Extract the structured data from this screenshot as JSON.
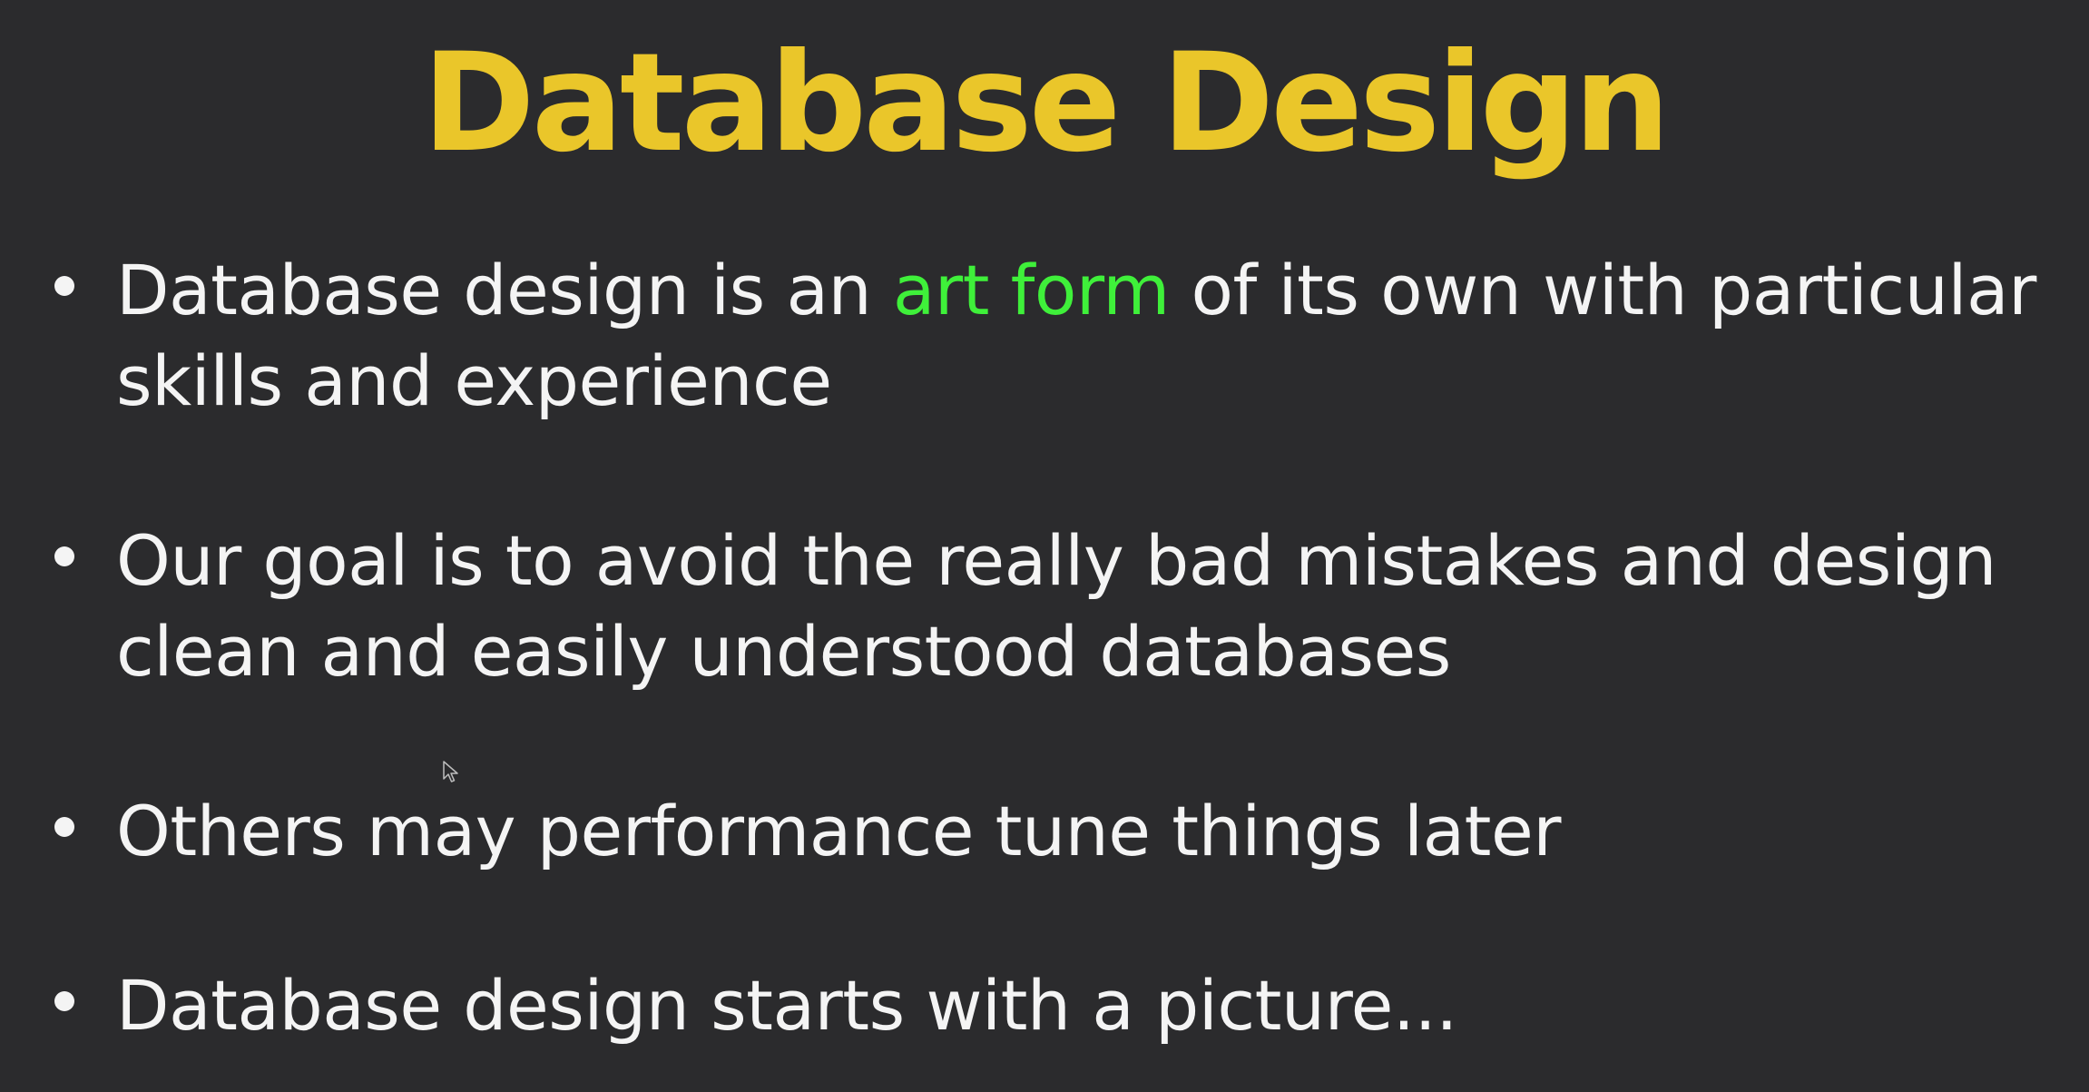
{
  "slide": {
    "title": "Database Design",
    "colors": {
      "background": "#2b2b2d",
      "title": "#eac62a",
      "text": "#f4f4f4",
      "accent": "#3ff03a"
    },
    "bullets": [
      {
        "before": "Database design is an ",
        "highlight": "art form",
        "after": " of its own with particular skills and experience"
      },
      {
        "text": "Our goal is to avoid the really bad mistakes and design clean and easily understood databases"
      },
      {
        "text": "Others may performance tune things later"
      },
      {
        "text": "Database design starts with a picture..."
      }
    ],
    "cursor_icon": "mouse-pointer-icon"
  }
}
